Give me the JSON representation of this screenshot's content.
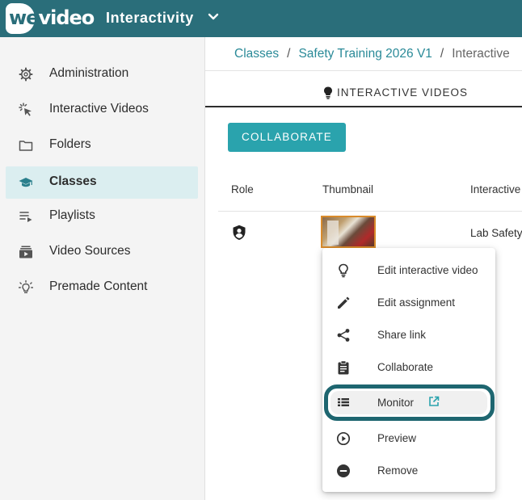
{
  "header": {
    "logo_text_we": "we",
    "logo_text_video": "video",
    "app_title": "Interactivity"
  },
  "sidebar": {
    "items": [
      {
        "label": "Administration",
        "icon": "gear-icon"
      },
      {
        "label": "Interactive Videos",
        "icon": "cursor-click-icon"
      },
      {
        "label": "Folders",
        "icon": "folder-icon"
      },
      {
        "label": "Classes",
        "icon": "graduation-cap-icon",
        "active": true
      },
      {
        "label": "Playlists",
        "icon": "playlist-icon"
      },
      {
        "label": "Video Sources",
        "icon": "video-library-icon"
      },
      {
        "label": "Premade Content",
        "icon": "lightbulb-icon"
      }
    ]
  },
  "breadcrumb": {
    "items": [
      "Classes",
      "Safety Training 2026 V1"
    ],
    "separator": "/",
    "current": "Interactive"
  },
  "tab": {
    "label": "INTERACTIVE VIDEOS",
    "icon": "lightbulb-icon"
  },
  "toolbar": {
    "collaborate_label": "COLLABORATE"
  },
  "table": {
    "columns": [
      "Role",
      "Thumbnail",
      "Interactive"
    ],
    "rows": [
      {
        "role_icon": "shield-user-icon",
        "title": "Lab Safety"
      }
    ]
  },
  "context_menu": {
    "items": [
      {
        "label": "Edit interactive video",
        "icon": "lightbulb-icon"
      },
      {
        "label": "Edit assignment",
        "icon": "pencil-icon"
      },
      {
        "label": "Share link",
        "icon": "share-icon"
      },
      {
        "label": "Collaborate",
        "icon": "clipboard-icon"
      },
      {
        "label": "Monitor",
        "icon": "list-icon",
        "external": true,
        "highlighted": true
      },
      {
        "label": "Preview",
        "icon": "play-circle-icon"
      },
      {
        "label": "Remove",
        "icon": "minus-circle-icon"
      }
    ]
  },
  "colors": {
    "header_bg": "#2a6e7a",
    "accent": "#2aa3ad",
    "link": "#2a8a98",
    "active_nav_bg": "#dbeef0",
    "highlight_ring": "#1e6670"
  }
}
